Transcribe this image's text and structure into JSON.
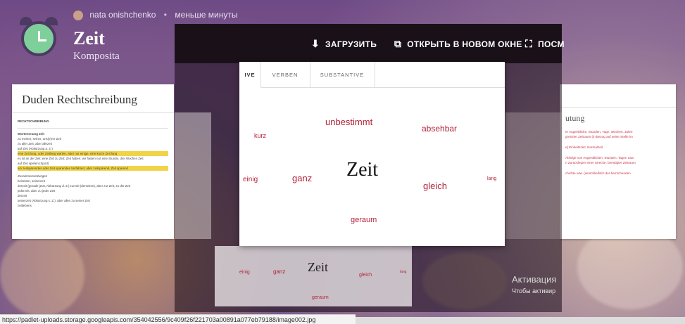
{
  "header": {
    "author": "nata onishchenko",
    "separator": "•",
    "time_ago": "меньше минуты",
    "title": "Zeit",
    "subtitle": "Komposita"
  },
  "viewer": {
    "download_label": "ЗАГРУЗИТЬ",
    "open_new_window_label": "ОТКРЫТЬ В НОВОМ ОКНЕ",
    "fullscreen_label_partial": "ПОСМ"
  },
  "left_card": {
    "title": "Duden Rechtschreibung",
    "section": "RECHTSCHREIBUNG",
    "heading": "Worttrennung Zeit",
    "lines": [
      "zu meiner, seiner, uns(e)rer Zeit",
      "zu aller Zeit, aber allezeit",
      "auf Zeit (Abkürzung a. Z.)",
      "eine Zeit lang, oder Zeitlang warten, aber nur einige, eine kurze Zeit lang",
      "es ist an der Zeit; eine Zeit zu Zeit; Zeit haben; wir haben nur eine Stunde, drei Wochen Zeit",
      "auf Zeit spielen (Sport)",
      "ein zeitsparendes oder Zeit sparendes Verfahren; aber zeitsparend, Zeit sparend"
    ],
    "sub_heading": "Zusammensetzungen",
    "lines2": [
      "beizeiten, seinerzeit",
      "derzeit (gerade jetzt, Abkürzung d. Z.) zurzeit (derzeiten), aber zur Zeit, zu der Zeit",
      "jederzeit, aber zu jeder Zeit",
      "derzeit",
      "seinerzeit (Abkürzung s. Z.), aber alles zu seiner Zeit",
      "zeitlebens"
    ]
  },
  "right_card": {
    "partial_heading": "utung",
    "lines": [
      "er Augenblicke, Stunden, Tage, Wochen, Jahre",
      "grenzter Zeitraum (in Bezug auf seine Stelle im",
      "e] Einheitszeit, Normalzeit",
      "Abfolge von Augenblicken, Stunden, Tagen usw.",
      "n Zurücklegen einer Strecke, benötigter Zeitraum",
      "chichte usw. (einschließlich der herrschenden"
    ]
  },
  "modal": {
    "tabs": [
      "IVE",
      "VERBEN",
      "SUBSTANTIVE"
    ],
    "center_word": "Zeit",
    "words": [
      {
        "text": "unbestimmt"
      },
      {
        "text": "absehbar"
      },
      {
        "text": "kurz"
      },
      {
        "text": "ganz"
      },
      {
        "text": "einig"
      },
      {
        "text": "gleich"
      },
      {
        "text": "lang"
      },
      {
        "text": "geraum"
      }
    ]
  },
  "background_card": {
    "center_word": "Zeit",
    "words": [
      "einig",
      "ganz",
      "gleich",
      "lang",
      "geraum"
    ]
  },
  "activation": {
    "title": "Активация",
    "line": "Чтобы активир"
  },
  "statusbar": {
    "url": "https://padlet-uploads.storage.googleapis.com/354042556/9c409f26f221703a00891a077eb79188/image002.jpg"
  },
  "colors": {
    "word_red": "#b3243a",
    "viewer_bar": "#1a1118"
  }
}
